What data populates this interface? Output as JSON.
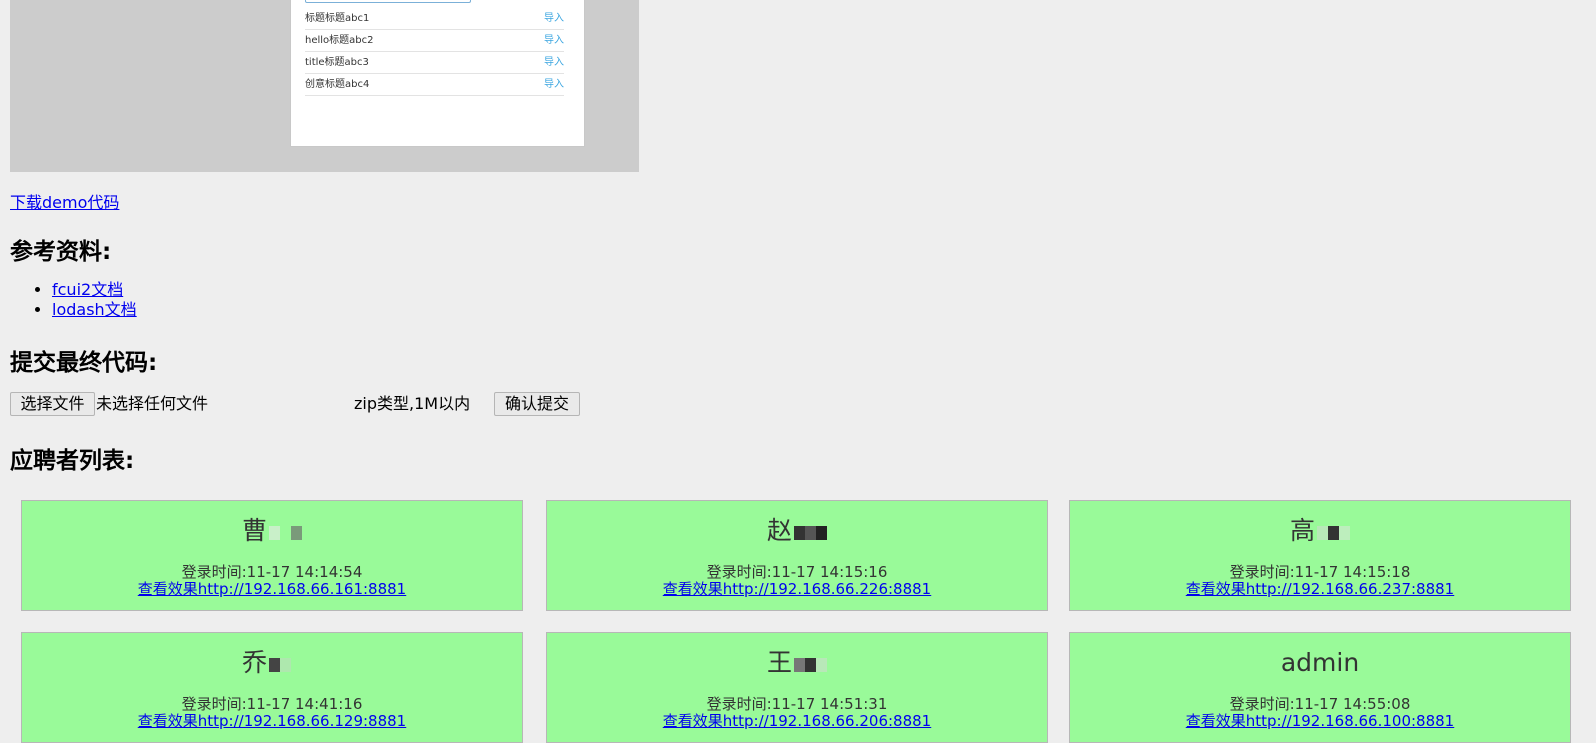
{
  "preview": {
    "rows": [
      {
        "title": "标题标题abc1",
        "action": "导入"
      },
      {
        "title": "hello标题abc2",
        "action": "导入"
      },
      {
        "title": "title标题abc3",
        "action": "导入"
      },
      {
        "title": "创意标题abc4",
        "action": "导入"
      }
    ]
  },
  "demo_link": "下载demo代码",
  "ref_heading": "参考资料:",
  "refs": [
    "fcui2文档",
    "lodash文档"
  ],
  "submit_heading": "提交最终代码:",
  "upload": {
    "choose_button": "选择文件",
    "file_status": "未选择任何文件",
    "hint": "zip类型,1M以内",
    "submit_button": "确认提交"
  },
  "list_heading": "应聘者列表:",
  "candidates": [
    {
      "name": "曹",
      "login": "登录时间:11-17 14:14:54",
      "link": "查看效果http://192.168.66.161:8881"
    },
    {
      "name": "赵",
      "login": "登录时间:11-17 14:15:16",
      "link": "查看效果http://192.168.66.226:8881"
    },
    {
      "name": "高",
      "login": "登录时间:11-17 14:15:18",
      "link": "查看效果http://192.168.66.237:8881"
    },
    {
      "name": "乔",
      "login": "登录时间:11-17 14:41:16",
      "link": "查看效果http://192.168.66.129:8881"
    },
    {
      "name": "王",
      "login": "登录时间:11-17 14:51:31",
      "link": "查看效果http://192.168.66.206:8881"
    },
    {
      "name": "admin",
      "login": "登录时间:11-17 14:55:08",
      "link": "查看效果http://192.168.66.100:8881"
    }
  ]
}
